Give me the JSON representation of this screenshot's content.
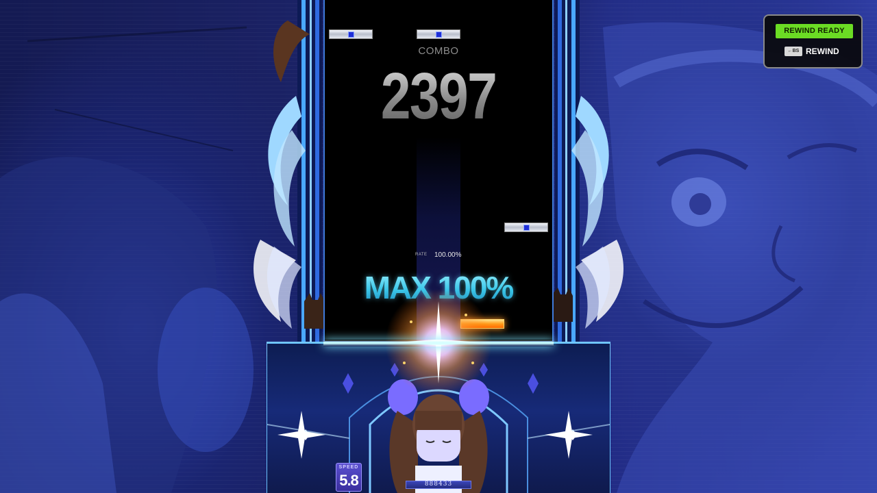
{
  "combo": {
    "label": "COMBO",
    "value": "2397"
  },
  "rate": {
    "label": "RATE",
    "value": "100.00%"
  },
  "judgement": {
    "text": "MAX 100%"
  },
  "speed": {
    "label": "SPEED",
    "value": "5.8"
  },
  "score": {
    "value": "888433"
  },
  "rewind": {
    "status": "REWIND READY",
    "key": "←BS",
    "action": "REWIND"
  },
  "notes": [
    {
      "lane": 1,
      "state": "normal"
    },
    {
      "lane": 3,
      "state": "normal"
    },
    {
      "lane": 5,
      "state": "normal"
    },
    {
      "lane": 4,
      "state": "hit"
    }
  ],
  "colors": {
    "rewind_ready_bg": "#6bdc24",
    "judgement_text": "#3cc8ea",
    "note_gem": "#1f2fd6",
    "playfield_border": "#3f7bdc"
  },
  "icons": [
    "backspace-key-icon",
    "sparkle-icon",
    "ornament-icon"
  ]
}
